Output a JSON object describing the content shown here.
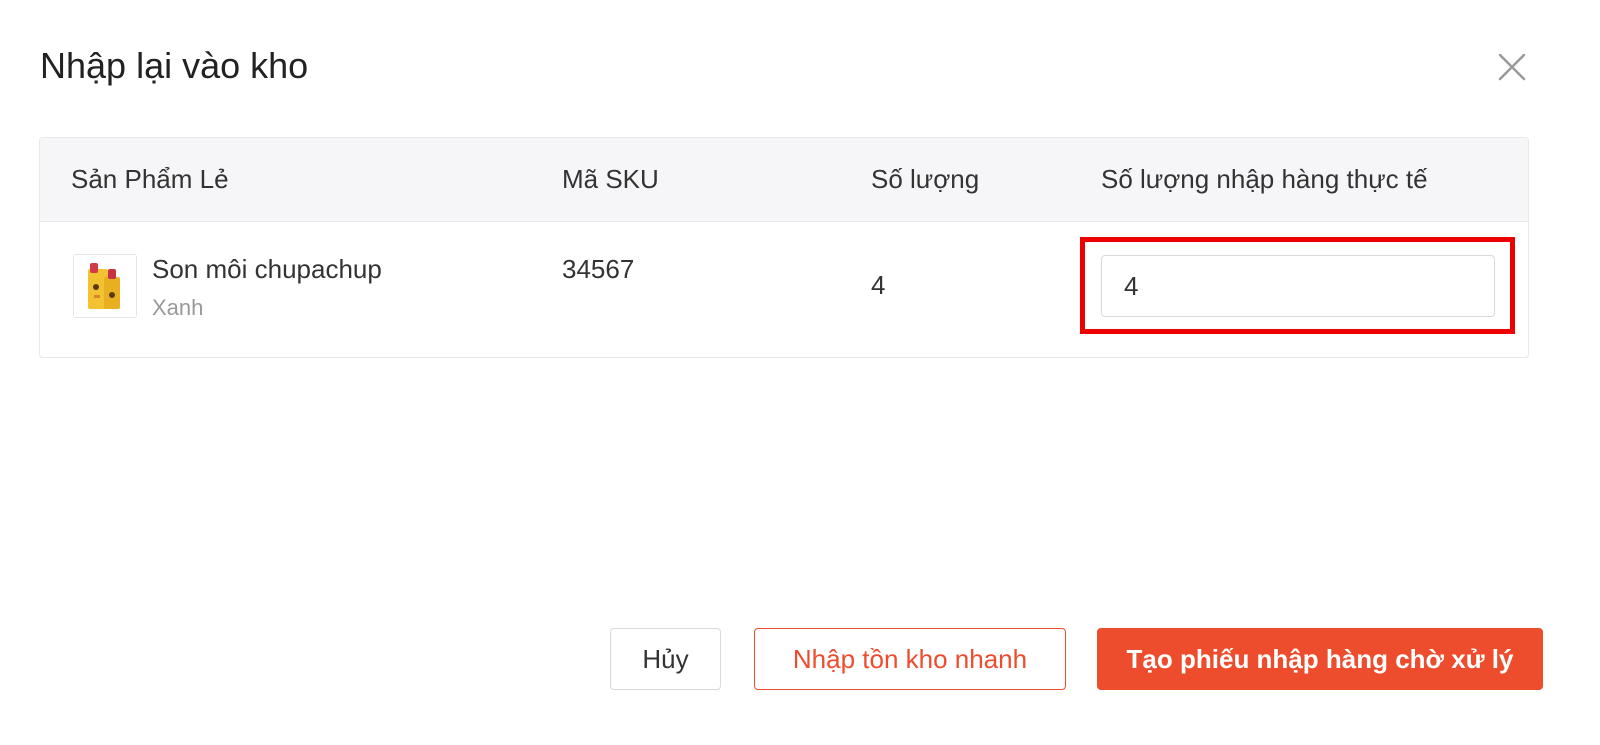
{
  "dialog": {
    "title": "Nhập lại vào kho",
    "close_icon": "close-icon"
  },
  "table": {
    "headers": {
      "product": "Sản Phẩm Lẻ",
      "sku": "Mã SKU",
      "quantity": "Số lượng",
      "actual_quantity": "Số lượng nhập hàng thực tế"
    },
    "rows": [
      {
        "thumbnail_icon": "lipstick-product-image",
        "name": "Son môi chupachup",
        "variant": "Xanh",
        "sku": "34567",
        "quantity": "4",
        "actual_quantity": "4"
      }
    ]
  },
  "footer": {
    "cancel_label": "Hủy",
    "quick_stock_label": "Nhập tồn kho nhanh",
    "create_label": "Tạo phiếu nhập hàng chờ xử lý"
  },
  "colors": {
    "accent": "#ee4d2d",
    "highlight": "#ee0000",
    "header_bg": "#f6f6f8"
  }
}
